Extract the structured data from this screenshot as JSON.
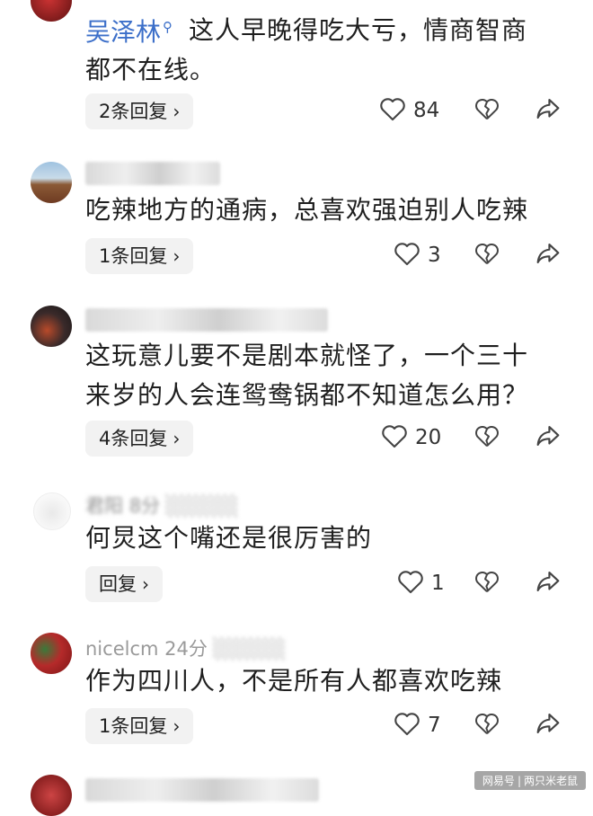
{
  "comments": [
    {
      "author": "吴泽林",
      "text_lines": [
        "这人早晚得吃大亏，情商智商",
        "都不在线。"
      ],
      "reply_label": "2条回复",
      "likes": "84"
    },
    {
      "text_lines": [
        "吃辣地方的通病，总喜欢强迫别人吃辣"
      ],
      "reply_label": "1条回复",
      "likes": "3"
    },
    {
      "text_lines": [
        "这玩意儿要不是剧本就怪了，一个三十",
        "来岁的人会连鸳鸯锅都不知道怎么用？"
      ],
      "reply_label": "4条回复",
      "likes": "20"
    },
    {
      "meta_name": "君阳",
      "meta_time": "8分",
      "text_lines": [
        "何炅这个嘴还是很厉害的"
      ],
      "reply_label": "回复",
      "likes": "1"
    },
    {
      "meta_name": "nicelcm",
      "meta_time": "24分",
      "text_lines": [
        "作为四川人，不是所有人都喜欢吃辣"
      ],
      "reply_label": "1条回复",
      "likes": "7"
    }
  ],
  "watermark": {
    "left": "网易号",
    "right": "两只米老鼠"
  },
  "colors": {
    "author": "#3c6fc9",
    "reply_bg": "#f2f2f2",
    "icon": "#444444"
  },
  "icons": {
    "like": "heart-outline-icon",
    "dislike": "broken-heart-icon",
    "share": "share-arrow-icon",
    "reply": "chevron-right-icon"
  }
}
